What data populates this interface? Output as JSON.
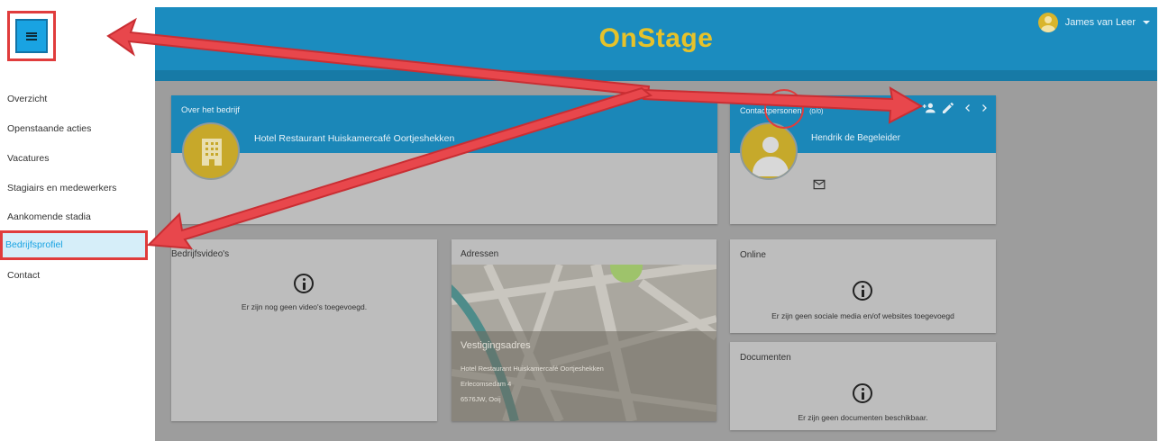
{
  "header": {
    "logo": "OnStage",
    "user_name": "James van Leer"
  },
  "sidebar": {
    "items": [
      {
        "label": "Overzicht"
      },
      {
        "label": "Openstaande acties"
      },
      {
        "label": "Vacatures"
      },
      {
        "label": "Stagiairs en medewerkers"
      },
      {
        "label": "Aankomende stadia"
      },
      {
        "label": "Bedrijfsprofiel",
        "active": true
      },
      {
        "label": "Contact"
      }
    ]
  },
  "company_card": {
    "title": "Over het bedrijf",
    "name": "Hotel Restaurant Huiskamercafé Oortjeshekken"
  },
  "contact_card": {
    "title": "Contactpersonen",
    "count": "(0/0)",
    "name": "Hendrik de Begeleider",
    "actions": [
      "add-person-icon",
      "edit-icon",
      "chevron-left-icon",
      "chevron-right-icon"
    ]
  },
  "video_card": {
    "title": "Bedrijfsvideo's",
    "empty_text": "Er zijn nog geen video's toegevoegd."
  },
  "address_card": {
    "title": "Adressen",
    "address_title": "Vestigingsadres",
    "line1": "Hotel Restaurant Huiskamercafé Oortjeshekken",
    "line2": "Erlecomsedam 4",
    "line3": "6576JW, Ooij"
  },
  "online_card": {
    "title": "Online",
    "empty_text": "Er zijn geen sociale media en/of websites toegevoegd"
  },
  "documents_card": {
    "title": "Documenten",
    "empty_text": "Er zijn geen documenten beschikbaar."
  },
  "colors": {
    "accent": "#19a3e2",
    "header": "#1b8cbf",
    "logo": "#e6c22a",
    "annotation": "#e03c3c"
  }
}
